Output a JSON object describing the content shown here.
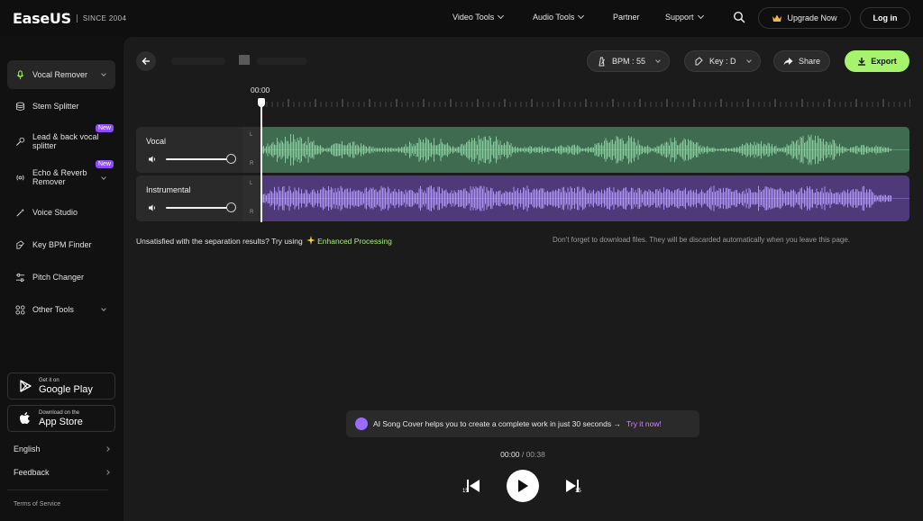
{
  "brand": {
    "logo": "EaseUS",
    "since": "SINCE 2004"
  },
  "nav": {
    "items": [
      {
        "label": "Video Tools",
        "dropdown": true
      },
      {
        "label": "Audio Tools",
        "dropdown": true
      },
      {
        "label": "Partner",
        "dropdown": false
      },
      {
        "label": "Support",
        "dropdown": true
      }
    ],
    "upgrade_label": "Upgrade Now",
    "login_label": "Log in"
  },
  "sidebar": {
    "items": [
      {
        "label": "Vocal Remover",
        "icon": "microphone-icon",
        "active": true,
        "dropdown": true
      },
      {
        "label": "Stem Splitter",
        "icon": "layers-icon"
      },
      {
        "label": "Lead & back vocal splitter",
        "icon": "mic-split-icon",
        "badge": "New"
      },
      {
        "label": "Echo & Reverb Remover",
        "icon": "echo-icon",
        "badge": "New",
        "dropdown": true
      },
      {
        "label": "Voice Studio",
        "icon": "magic-wand-icon"
      },
      {
        "label": "Key BPM Finder",
        "icon": "key-finder-icon"
      },
      {
        "label": "Pitch Changer",
        "icon": "sliders-icon"
      },
      {
        "label": "Other Tools",
        "icon": "grid-icon",
        "dropdown": true
      }
    ],
    "google_play": {
      "small": "Get it on",
      "big": "Google Play"
    },
    "app_store": {
      "small": "Download on the",
      "big": "App Store"
    },
    "language": "English",
    "feedback": "Feedback",
    "terms": "Terms of Service"
  },
  "editor": {
    "bpm_label": "BPM : 55",
    "key_label": "Key : D",
    "share_label": "Share",
    "export_label": "Export",
    "current_time": "00:00",
    "tracks": [
      {
        "name": "Vocal",
        "color": "#3f6b50",
        "wave_color": "#8fd5a6",
        "volume": 1.0,
        "channels": [
          "L",
          "R"
        ]
      },
      {
        "name": "Instrumental",
        "color": "#4e3a78",
        "wave_color": "#b79cff",
        "volume": 1.0,
        "channels": [
          "L",
          "R"
        ]
      }
    ],
    "hint_left": "Unsatisfied with the separation results? Try using",
    "hint_enhanced": "Enhanced Processing",
    "hint_right": "Don't forget to download files. They will be discarded automatically when you leave this page."
  },
  "promo": {
    "text": "AI Song Cover helps you to create a complete work in just 30 seconds →",
    "link": "Try it now!"
  },
  "player": {
    "elapsed": "00:00",
    "separator": "/",
    "duration": "00:38",
    "skip_back": "15",
    "skip_forward": "15"
  },
  "colors": {
    "accent": "#a6f36c",
    "badge": "#8d4dff",
    "link": "#d084ff"
  }
}
